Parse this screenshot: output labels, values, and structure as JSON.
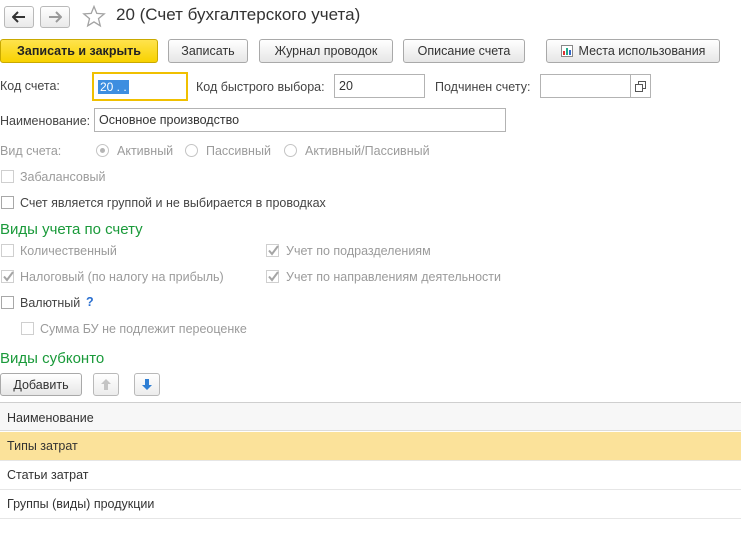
{
  "window": {
    "title": "20 (Счет бухгалтерского учета)"
  },
  "toolbar": {
    "save_close": "Записать и закрыть",
    "save": "Записать",
    "journal": "Журнал проводок",
    "description": "Описание счета",
    "usage": "Места использования"
  },
  "form": {
    "code_label": "Код счета:",
    "code_value": "20 .  .",
    "quick_label": "Код быстрого выбора:",
    "quick_value": "20",
    "parent_label": "Подчинен счету:",
    "parent_value": "",
    "name_label": "Наименование:",
    "name_value": "Основное производство",
    "type_label": "Вид счета:",
    "type_options": [
      "Активный",
      "Пассивный",
      "Активный/Пассивный"
    ],
    "offbalance_label": "Забалансовый",
    "group_label": "Счет является группой и не выбирается в проводках"
  },
  "accounting": {
    "section_title": "Виды учета по счету",
    "quantity": "Количественный",
    "tax": "Налоговый (по налогу на прибыль)",
    "divisions": "Учет по подразделениям",
    "activities": "Учет по направлениям деятельности",
    "currency": "Валютный",
    "help": "?",
    "revaluation": "Сумма БУ не подлежит переоценке"
  },
  "subconto": {
    "section_title": "Виды субконто",
    "add_button": "Добавить",
    "column_header": "Наименование",
    "rows": [
      "Типы затрат",
      "Статьи затрат",
      "Группы (виды) продукции"
    ]
  },
  "colors": {
    "primary_button": "#f8d200",
    "section_title": "#1a9a3a",
    "selected_row": "#fbe29a",
    "focus_border": "#f0c000"
  }
}
